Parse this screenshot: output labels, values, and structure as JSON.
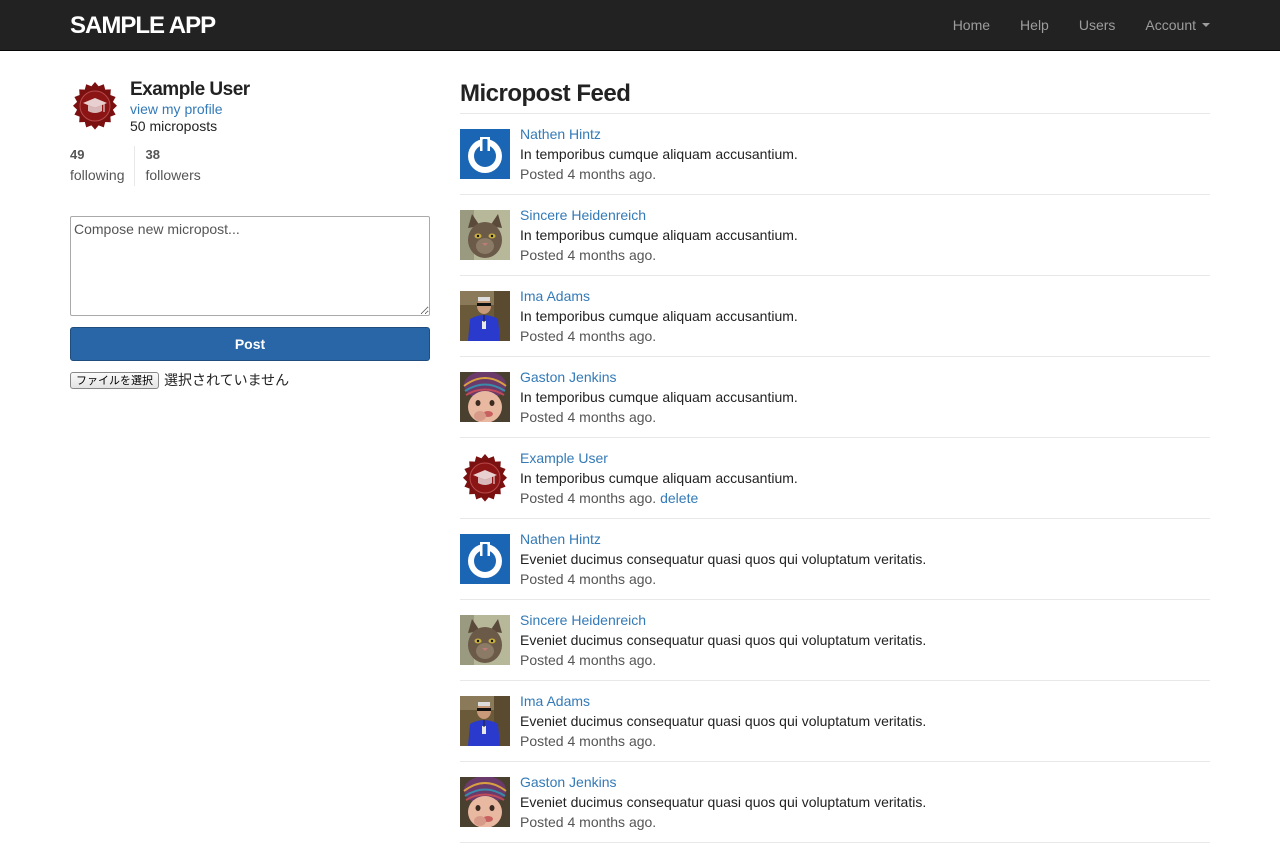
{
  "header": {
    "logo": "SAMPLE APP",
    "nav": {
      "home": "Home",
      "help": "Help",
      "users": "Users",
      "account": "Account"
    }
  },
  "sidebar": {
    "user_name": "Example User",
    "profile_link": "view my profile",
    "microposts_count": "50 microposts",
    "following_count": "49",
    "following_label": "following",
    "followers_count": "38",
    "followers_label": "followers"
  },
  "composer": {
    "placeholder": "Compose new micropost...",
    "post_label": "Post",
    "file_button": "ファイルを選択",
    "file_status": "選択されていません"
  },
  "feed": {
    "title": "Micropost Feed",
    "delete_label": "delete",
    "items": [
      {
        "author": "Nathen Hintz",
        "content": "In temporibus cumque aliquam accusantium.",
        "timestamp": "Posted 4 months ago."
      },
      {
        "author": "Sincere Heidenreich",
        "content": "In temporibus cumque aliquam accusantium.",
        "timestamp": "Posted 4 months ago."
      },
      {
        "author": "Ima Adams",
        "content": "In temporibus cumque aliquam accusantium.",
        "timestamp": "Posted 4 months ago."
      },
      {
        "author": "Gaston Jenkins",
        "content": "In temporibus cumque aliquam accusantium.",
        "timestamp": "Posted 4 months ago."
      },
      {
        "author": "Example User",
        "content": "In temporibus cumque aliquam accusantium.",
        "timestamp": "Posted 4 months ago."
      },
      {
        "author": "Nathen Hintz",
        "content": "Eveniet ducimus consequatur quasi quos qui voluptatum veritatis.",
        "timestamp": "Posted 4 months ago."
      },
      {
        "author": "Sincere Heidenreich",
        "content": "Eveniet ducimus consequatur quasi quos qui voluptatum veritatis.",
        "timestamp": "Posted 4 months ago."
      },
      {
        "author": "Ima Adams",
        "content": "Eveniet ducimus consequatur quasi quos qui voluptatum veritatis.",
        "timestamp": "Posted 4 months ago."
      },
      {
        "author": "Gaston Jenkins",
        "content": "Eveniet ducimus consequatur quasi quos qui voluptatum veritatis.",
        "timestamp": "Posted 4 months ago."
      }
    ]
  },
  "colors": {
    "navbar": "#222222",
    "link": "#337ab7",
    "button": "#2866a8",
    "avatar_badge": "#7a1010",
    "avatar_power": "#1a66b5"
  }
}
